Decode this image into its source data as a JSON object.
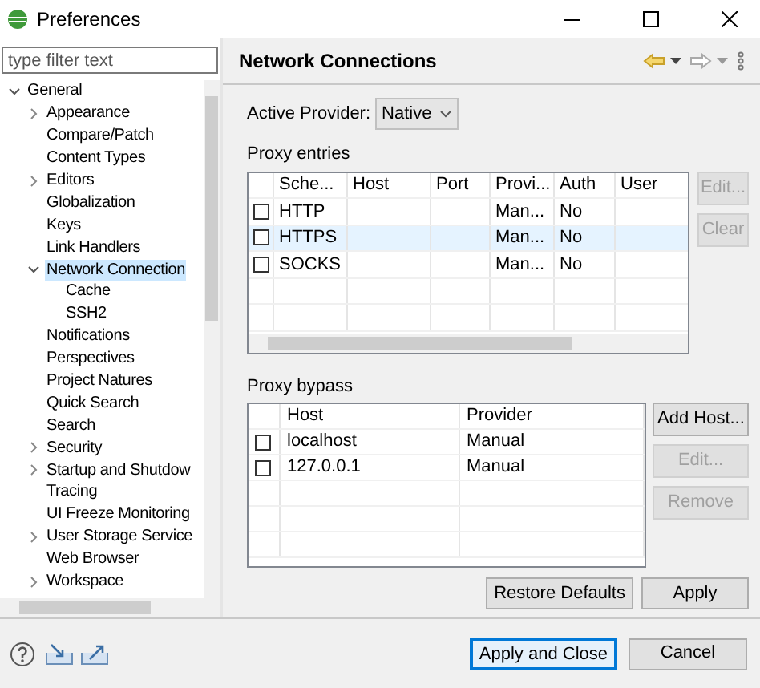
{
  "window": {
    "title": "Preferences"
  },
  "filter": {
    "placeholder": "type filter text"
  },
  "tree": [
    {
      "label": "General",
      "expanded": true,
      "selected": false,
      "children": [
        {
          "label": "Appearance",
          "expanded": false,
          "selected": false
        },
        {
          "label": "Compare/Patch",
          "selected": false
        },
        {
          "label": "Content Types",
          "selected": false
        },
        {
          "label": "Editors",
          "expanded": false,
          "selected": false
        },
        {
          "label": "Globalization",
          "selected": false
        },
        {
          "label": "Keys",
          "selected": false
        },
        {
          "label": "Link Handlers",
          "selected": false
        },
        {
          "label": "Network Connection",
          "expanded": true,
          "selected": true,
          "children": [
            {
              "label": "Cache",
              "selected": false
            },
            {
              "label": "SSH2",
              "selected": false
            }
          ]
        },
        {
          "label": "Notifications",
          "selected": false
        },
        {
          "label": "Perspectives",
          "selected": false
        },
        {
          "label": "Project Natures",
          "selected": false
        },
        {
          "label": "Quick Search",
          "selected": false
        },
        {
          "label": "Search",
          "selected": false
        },
        {
          "label": "Security",
          "expanded": false,
          "selected": false
        },
        {
          "label": "Startup and Shutdow",
          "expanded": false,
          "selected": false
        },
        {
          "label": "Tracing",
          "selected": false
        },
        {
          "label": "UI Freeze Monitoring",
          "selected": false
        },
        {
          "label": "User Storage Service",
          "expanded": false,
          "selected": false
        },
        {
          "label": "Web Browser",
          "selected": false
        },
        {
          "label": "Workspace",
          "expanded": false,
          "selected": false
        }
      ]
    }
  ],
  "page": {
    "title": "Network Connections",
    "provider": {
      "label": "Active Provider:",
      "value": "Native"
    },
    "proxy_entries": {
      "label": "Proxy entries",
      "columns": [
        "Sche...",
        "Host",
        "Port",
        "Provi...",
        "Auth",
        "User"
      ],
      "rows": [
        {
          "checked": false,
          "selected": false,
          "cells": [
            "HTTP",
            "",
            "",
            "Man...",
            "No",
            ""
          ]
        },
        {
          "checked": false,
          "selected": true,
          "cells": [
            "HTTPS",
            "",
            "",
            "Man...",
            "No",
            ""
          ]
        },
        {
          "checked": false,
          "selected": false,
          "cells": [
            "SOCKS",
            "",
            "",
            "Man...",
            "No",
            ""
          ]
        }
      ],
      "buttons": [
        {
          "label": "Edit...",
          "disabled": true
        },
        {
          "label": "Clear",
          "disabled": true
        }
      ]
    },
    "proxy_bypass": {
      "label": "Proxy bypass",
      "columns": [
        "Host",
        "Provider"
      ],
      "rows": [
        {
          "checked": false,
          "cells": [
            "localhost",
            "Manual"
          ]
        },
        {
          "checked": false,
          "cells": [
            "127.0.0.1",
            "Manual"
          ]
        }
      ],
      "buttons": [
        {
          "label": "Add Host...",
          "disabled": false
        },
        {
          "label": "Edit...",
          "disabled": true
        },
        {
          "label": "Remove",
          "disabled": true
        }
      ]
    },
    "buttons": [
      {
        "label": "Restore Defaults"
      },
      {
        "label": "Apply"
      }
    ]
  },
  "footer_buttons": [
    {
      "label": "Apply and Close",
      "default": true
    },
    {
      "label": "Cancel",
      "default": false
    }
  ]
}
